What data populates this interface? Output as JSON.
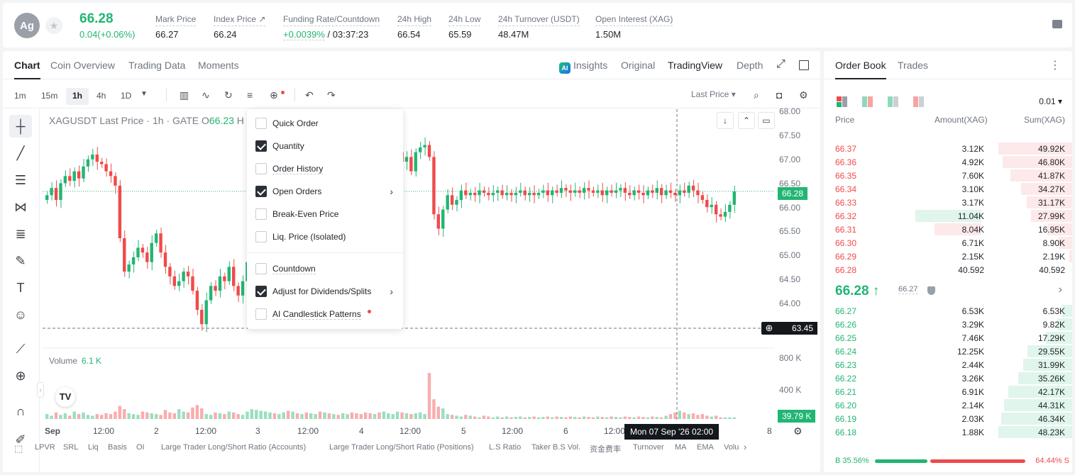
{
  "header": {
    "avatar": "Ag",
    "price": "66.28",
    "change": "0.04(+0.06%)",
    "stats": [
      {
        "label": "Mark Price",
        "value": "66.27"
      },
      {
        "label": "Index Price ↗",
        "value": "66.24"
      },
      {
        "label": "Funding Rate/Countdown",
        "value_green": "+0.0039%",
        "value": " / 03:37:23"
      },
      {
        "label": "24h High",
        "value": "66.54"
      },
      {
        "label": "24h Low",
        "value": "65.59"
      },
      {
        "label": "24h Turnover (USDT)",
        "value": "48.47M"
      },
      {
        "label": "Open Interest (XAG)",
        "value": "1.50M"
      }
    ]
  },
  "chart_tabs": [
    "Chart",
    "Coin Overview",
    "Trading Data",
    "Moments"
  ],
  "chart_views": {
    "ai_badge": "AI",
    "insights": "Insights",
    "original": "Original",
    "tradingview": "TradingView",
    "depth": "Depth"
  },
  "timeframes": [
    "1m",
    "15m",
    "1h",
    "4h",
    "1D"
  ],
  "active_timeframe": "1h",
  "last_price_select": "Last Price",
  "symbol_title": {
    "text": "XAGUSDT Last Price · 1h · GATE  O",
    "open": "66.23",
    "suffix": " H"
  },
  "menu": {
    "items": [
      {
        "label": "Quick Order",
        "checked": false
      },
      {
        "label": "Quantity",
        "checked": true
      },
      {
        "label": "Order History",
        "checked": false
      },
      {
        "label": "Open Orders",
        "checked": true,
        "submenu": true
      },
      {
        "label": "Break-Even Price",
        "checked": false
      },
      {
        "label": "Liq. Price (Isolated)",
        "checked": false
      },
      {
        "label": "Countdown",
        "checked": false
      },
      {
        "label": "Adjust for Dividends/Splits",
        "checked": true,
        "submenu": true
      },
      {
        "label": "AI Candlestick Patterns",
        "checked": false,
        "dot": true
      }
    ]
  },
  "y_axis": {
    "ticks": [
      "68.00",
      "67.50",
      "67.00",
      "66.50",
      "66.00",
      "65.50",
      "65.00",
      "64.50",
      "64.00"
    ],
    "current_price": "66.28",
    "crosshair_price": "63.45",
    "volume_ticks": [
      "800 K",
      "400 K"
    ],
    "volume_current": "39.79 K"
  },
  "volume": {
    "label": "Volume",
    "value": "6.1 K"
  },
  "x_axis": {
    "ticks": [
      "Sep",
      "12:00",
      "2",
      "12:00",
      "3",
      "12:00",
      "4",
      "12:00",
      "5",
      "12:00",
      "6",
      "12:00",
      "8"
    ],
    "crosshair_time": "Mon 07 Sep '26   02:00"
  },
  "indicators": [
    "LPVR",
    "SRL",
    "Liq",
    "Basis",
    "OI",
    "Large Trader Long/Short Ratio (Accounts)",
    "Large Trader Long/Short Ratio (Positions)",
    "L.S Ratio",
    "Taker B.S Vol.",
    "资金费率",
    "Turnover",
    "MA",
    "EMA",
    "Volu"
  ],
  "chart_data": {
    "type": "candlestick",
    "timeframe": "1h",
    "ylim": [
      63.4,
      68.0
    ],
    "current_price": 66.28,
    "x_labels": [
      "Sep",
      "12:00",
      "2",
      "12:00",
      "3",
      "12:00",
      "4",
      "12:00",
      "5",
      "12:00",
      "6",
      "12:00",
      "8"
    ],
    "closes": [
      66.2,
      66.35,
      66.1,
      66.45,
      66.6,
      66.5,
      66.7,
      66.55,
      66.8,
      66.95,
      67.05,
      66.9,
      66.85,
      66.7,
      66.6,
      66.4,
      65.3,
      64.6,
      64.75,
      64.9,
      65.1,
      65.0,
      64.8,
      65.2,
      65.4,
      65.0,
      64.7,
      64.5,
      64.3,
      64.4,
      64.6,
      64.5,
      64.2,
      63.8,
      63.5,
      64.0,
      64.3,
      64.2,
      64.5,
      64.4,
      64.7,
      64.3,
      64.1,
      64.4,
      64.8,
      65.2,
      65.6,
      66.0,
      66.3,
      66.5,
      66.4,
      66.6,
      66.7,
      66.5,
      66.9,
      66.8,
      67.0,
      66.7,
      66.9,
      67.1,
      66.8,
      66.9,
      66.7,
      67.0,
      66.9,
      67.1,
      67.2,
      67.0,
      66.9,
      66.8,
      66.6,
      66.5,
      66.7,
      66.6,
      66.8,
      66.9,
      67.0,
      67.1,
      66.9,
      67.0,
      66.7,
      67.1,
      67.2,
      67.25,
      67.0,
      65.8,
      65.5,
      65.9,
      66.2,
      66.0,
      66.1,
      66.3,
      66.2,
      66.25,
      66.2,
      66.3,
      66.25,
      66.2,
      66.25,
      66.3,
      66.2,
      66.25,
      66.2,
      66.25,
      66.3,
      66.2,
      66.25,
      66.2,
      66.25,
      66.3,
      66.2,
      66.3,
      66.25,
      66.35,
      66.3,
      66.25,
      66.3,
      66.25,
      66.35,
      66.3,
      66.25,
      66.3,
      66.2,
      66.3,
      66.25,
      66.3,
      66.35,
      66.25,
      66.2,
      66.3,
      66.25,
      66.2,
      66.3,
      66.25,
      66.35,
      66.2,
      66.3,
      66.25,
      66.2,
      66.3,
      66.25,
      66.4,
      66.3,
      66.2,
      66.1,
      65.95,
      66.0,
      65.8,
      65.75,
      65.85,
      66.0,
      66.28
    ],
    "volumes_k": [
      60,
      40,
      80,
      50,
      70,
      40,
      90,
      60,
      80,
      50,
      40,
      60,
      50,
      70,
      60,
      90,
      160,
      120,
      70,
      60,
      50,
      90,
      80,
      70,
      60,
      50,
      110,
      80,
      70,
      120,
      90,
      80,
      140,
      170,
      130,
      60,
      50,
      80,
      70,
      60,
      90,
      80,
      60,
      50,
      90,
      120,
      110,
      100,
      90,
      80,
      70,
      60,
      80,
      100,
      90,
      70,
      60,
      80,
      70,
      60,
      90,
      80,
      70,
      60,
      50,
      70,
      60,
      80,
      70,
      60,
      80,
      70,
      60,
      80,
      90,
      70,
      60,
      90,
      80,
      70,
      60,
      70,
      80,
      60,
      560,
      240,
      150,
      130,
      60,
      50,
      40,
      30,
      50,
      40,
      30,
      20,
      40,
      30,
      20,
      30,
      20,
      30,
      20,
      25,
      30,
      20,
      25,
      30,
      20,
      25,
      30,
      20,
      30,
      25,
      20,
      30,
      25,
      20,
      30,
      25,
      20,
      30,
      25,
      20,
      30,
      25,
      20,
      30,
      25,
      20,
      30,
      25,
      20,
      30,
      25,
      20,
      40,
      60,
      80,
      100,
      80,
      60,
      70,
      50,
      60,
      40,
      30,
      40
    ]
  },
  "orderbook": {
    "tabs": [
      "Order Book",
      "Trades"
    ],
    "precision": "0.01 ▾",
    "headers": {
      "price": "Price",
      "amount": "Amount(XAG)",
      "sum": "Sum(XAG)"
    },
    "asks": [
      {
        "price": "66.37",
        "amount": "3.12K",
        "sum": "49.92K",
        "depth": 1.0
      },
      {
        "price": "66.36",
        "amount": "4.92K",
        "sum": "46.80K",
        "depth": 0.94
      },
      {
        "price": "66.35",
        "amount": "7.60K",
        "sum": "41.87K",
        "depth": 0.84
      },
      {
        "price": "66.34",
        "amount": "3.10K",
        "sum": "34.27K",
        "depth": 0.69
      },
      {
        "price": "66.33",
        "amount": "3.17K",
        "sum": "31.17K",
        "depth": 0.62
      },
      {
        "price": "66.32",
        "amount": "11.04K",
        "sum": "27.99K",
        "depth": 0.56,
        "amount_highlight": 0.22
      },
      {
        "price": "66.31",
        "amount": "8.04K",
        "sum": "16.95K",
        "depth": 0.34,
        "amount_highlight": 0.16
      },
      {
        "price": "66.30",
        "amount": "6.71K",
        "sum": "8.90K",
        "depth": 0.18
      },
      {
        "price": "66.29",
        "amount": "2.15K",
        "sum": "2.19K",
        "depth": 0.04
      },
      {
        "price": "66.28",
        "amount": "40.592",
        "sum": "40.592",
        "depth": 0.0
      }
    ],
    "mid": {
      "price": "66.28 ↑",
      "mark": "66.27"
    },
    "bids": [
      {
        "price": "66.27",
        "amount": "6.53K",
        "sum": "6.53K",
        "depth": 0.14
      },
      {
        "price": "66.26",
        "amount": "3.29K",
        "sum": "9.82K",
        "depth": 0.2
      },
      {
        "price": "66.25",
        "amount": "7.46K",
        "sum": "17.29K",
        "depth": 0.36
      },
      {
        "price": "66.24",
        "amount": "12.25K",
        "sum": "29.55K",
        "depth": 0.61
      },
      {
        "price": "66.23",
        "amount": "2.44K",
        "sum": "31.99K",
        "depth": 0.66
      },
      {
        "price": "66.22",
        "amount": "3.26K",
        "sum": "35.26K",
        "depth": 0.73
      },
      {
        "price": "66.21",
        "amount": "6.91K",
        "sum": "42.17K",
        "depth": 0.87
      },
      {
        "price": "66.20",
        "amount": "2.14K",
        "sum": "44.31K",
        "depth": 0.92
      },
      {
        "price": "66.19",
        "amount": "2.03K",
        "sum": "46.34K",
        "depth": 0.96
      },
      {
        "price": "66.18",
        "amount": "1.88K",
        "sum": "48.23K",
        "depth": 1.0
      }
    ],
    "buy_ratio": "B 35.56%",
    "sell_ratio": "64.44% S",
    "buy_fraction": 0.3556
  },
  "colors": {
    "up": "#22b573",
    "down": "#f04a4a",
    "text": "#1f2329",
    "muted": "#6f7680"
  }
}
